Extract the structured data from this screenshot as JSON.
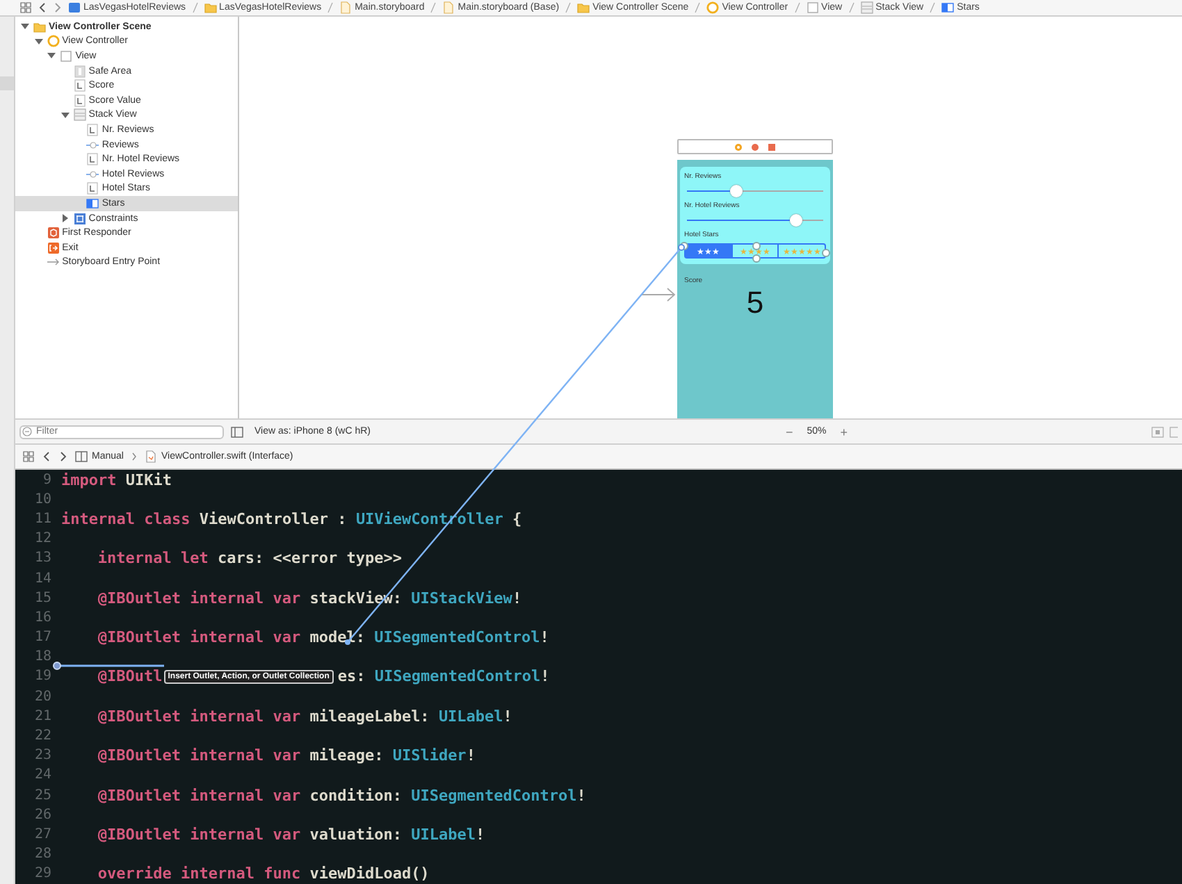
{
  "breadcrumb": [
    {
      "label": "LasVegasHotelReviews",
      "kind": "project"
    },
    {
      "label": "LasVegasHotelReviews",
      "kind": "folder"
    },
    {
      "label": "Main.storyboard",
      "kind": "storyboard"
    },
    {
      "label": "Main.storyboard (Base)",
      "kind": "storyboard"
    },
    {
      "label": "View Controller Scene",
      "kind": "folder"
    },
    {
      "label": "View Controller",
      "kind": "controller"
    },
    {
      "label": "View",
      "kind": "view"
    },
    {
      "label": "Stack View",
      "kind": "stack"
    },
    {
      "label": "Stars",
      "kind": "segmented"
    }
  ],
  "outline": {
    "items": [
      {
        "label": "View Controller Scene",
        "kind": "folder",
        "expanded": true,
        "selected": false,
        "children": [
          {
            "label": "View Controller",
            "kind": "controller",
            "expanded": true,
            "selected": false,
            "children": [
              {
                "label": "View",
                "kind": "view",
                "expanded": true,
                "selected": false,
                "children": [
                  {
                    "label": "Safe Area",
                    "kind": "safearea",
                    "selected": false
                  },
                  {
                    "label": "Score",
                    "kind": "label",
                    "selected": false
                  },
                  {
                    "label": "Score Value",
                    "kind": "label",
                    "selected": false
                  },
                  {
                    "label": "Stack View",
                    "kind": "stack",
                    "expanded": true,
                    "selected": false,
                    "children": [
                      {
                        "label": "Nr. Reviews",
                        "kind": "label",
                        "selected": false
                      },
                      {
                        "label": "Reviews",
                        "kind": "slider",
                        "selected": false
                      },
                      {
                        "label": "Nr. Hotel Reviews",
                        "kind": "label",
                        "selected": false
                      },
                      {
                        "label": "Hotel Reviews",
                        "kind": "slider",
                        "selected": false
                      },
                      {
                        "label": "Hotel Stars",
                        "kind": "label",
                        "selected": false
                      },
                      {
                        "label": "Stars",
                        "kind": "segmented",
                        "selected": true
                      }
                    ]
                  },
                  {
                    "label": "Constraints",
                    "kind": "constraints",
                    "expanded": false,
                    "selected": false
                  }
                ]
              }
            ]
          },
          {
            "label": "First Responder",
            "kind": "responder",
            "selected": false
          },
          {
            "label": "Exit",
            "kind": "exit",
            "selected": false
          },
          {
            "label": "Storyboard Entry Point",
            "kind": "entry",
            "selected": false
          }
        ]
      }
    ],
    "filter": {
      "placeholder": "Filter"
    }
  },
  "canvas": {
    "scene": {
      "rows": [
        {
          "kind": "label",
          "text": "Nr. Reviews"
        },
        {
          "kind": "slider",
          "level": 0.36
        },
        {
          "kind": "label",
          "text": "Nr. Hotel Reviews"
        },
        {
          "kind": "slider",
          "level": 0.8
        },
        {
          "kind": "label",
          "text": "Hotel Stars"
        },
        {
          "kind": "segmented",
          "segments": [
            {
              "label": "★★★",
              "selected": true
            },
            {
              "label": "★★★★",
              "selected": false
            },
            {
              "label": "★★★★★",
              "selected": false
            }
          ]
        }
      ],
      "score_label": "Score",
      "score_value": "5"
    },
    "view_as": "View as: iPhone 8 (wC hR)",
    "zoom_out": "−",
    "zoom": "50%",
    "zoom_in": "+"
  },
  "jump_bar": [
    {
      "label": "Manual",
      "kind": "document"
    },
    {
      "label": "ViewController.swift (Interface)",
      "kind": "swift"
    }
  ],
  "code": {
    "lines": [
      {
        "number": "9",
        "indented": false,
        "parts": [
          {
            "tokens": [
              {
                "kind": "keyword",
                "text": "import"
              },
              {
                "kind": "plain",
                "text": " UIKit"
              }
            ]
          }
        ]
      },
      {
        "number": "10"
      },
      {
        "number": "11",
        "indented": false,
        "parts": [
          {
            "tokens": [
              {
                "kind": "keyword",
                "text": "internal class"
              },
              {
                "kind": "plain",
                "text": " ViewController : "
              },
              {
                "kind": "type",
                "text": "UIViewController"
              },
              {
                "kind": "plain",
                "text": " {"
              }
            ]
          }
        ]
      },
      {
        "number": "12"
      },
      {
        "number": "13",
        "indented": true,
        "parts": [
          {
            "tokens": [
              {
                "kind": "keyword",
                "text": "internal let"
              },
              {
                "kind": "plain",
                "text": " cars: <<error type>>"
              }
            ]
          }
        ]
      },
      {
        "number": "14"
      },
      {
        "number": "15",
        "indented": true,
        "parts": [
          {
            "tokens": [
              {
                "kind": "keyword",
                "text": "@IBOutlet internal var"
              },
              {
                "kind": "plain",
                "text": " stackView: "
              },
              {
                "kind": "type",
                "text": "UIStackView"
              },
              {
                "kind": "plain",
                "text": "!"
              }
            ]
          }
        ]
      },
      {
        "number": "16"
      },
      {
        "number": "17",
        "indented": true,
        "parts": [
          {
            "tokens": [
              {
                "kind": "keyword",
                "text": "@IBOutlet internal var"
              },
              {
                "kind": "plain",
                "text": " model: "
              },
              {
                "kind": "type",
                "text": "UISegmentedControl"
              },
              {
                "kind": "plain",
                "text": "!"
              }
            ]
          }
        ]
      },
      {
        "number": "18"
      },
      {
        "number": "19",
        "indented": true,
        "parts": [
          {
            "tokens": [
              {
                "kind": "keyword",
                "text": "@IBOutl"
              }
            ]
          },
          {
            "tooltip": "Insert Outlet, Action, or Outlet Collection"
          },
          {
            "tokens": [
              {
                "kind": "plain",
                "text": "es: "
              },
              {
                "kind": "type",
                "text": "UISegmentedControl"
              },
              {
                "kind": "plain",
                "text": "!"
              }
            ]
          }
        ]
      },
      {
        "number": "20"
      },
      {
        "number": "21",
        "indented": true,
        "parts": [
          {
            "tokens": [
              {
                "kind": "keyword",
                "text": "@IBOutlet internal var"
              },
              {
                "kind": "plain",
                "text": " mileageLabel: "
              },
              {
                "kind": "type",
                "text": "UILabel"
              },
              {
                "kind": "plain",
                "text": "!"
              }
            ]
          }
        ]
      },
      {
        "number": "22"
      },
      {
        "number": "23",
        "indented": true,
        "parts": [
          {
            "tokens": [
              {
                "kind": "keyword",
                "text": "@IBOutlet internal var"
              },
              {
                "kind": "plain",
                "text": " mileage: "
              },
              {
                "kind": "type",
                "text": "UISlider"
              },
              {
                "kind": "plain",
                "text": "!"
              }
            ]
          }
        ]
      },
      {
        "number": "24"
      },
      {
        "number": "25",
        "indented": true,
        "parts": [
          {
            "tokens": [
              {
                "kind": "keyword",
                "text": "@IBOutlet internal var"
              },
              {
                "kind": "plain",
                "text": " condition: "
              },
              {
                "kind": "type",
                "text": "UISegmentedControl"
              },
              {
                "kind": "plain",
                "text": "!"
              }
            ]
          }
        ]
      },
      {
        "number": "26"
      },
      {
        "number": "27",
        "indented": true,
        "parts": [
          {
            "tokens": [
              {
                "kind": "keyword",
                "text": "@IBOutlet internal var"
              },
              {
                "kind": "plain",
                "text": " valuation: "
              },
              {
                "kind": "type",
                "text": "UILabel"
              },
              {
                "kind": "plain",
                "text": "!"
              }
            ]
          }
        ]
      },
      {
        "number": "28"
      },
      {
        "number": "29",
        "indented": true,
        "parts": [
          {
            "tokens": [
              {
                "kind": "keyword",
                "text": "override internal func"
              },
              {
                "kind": "plain",
                "text": " viewDidLoad()"
              }
            ]
          }
        ]
      }
    ]
  }
}
